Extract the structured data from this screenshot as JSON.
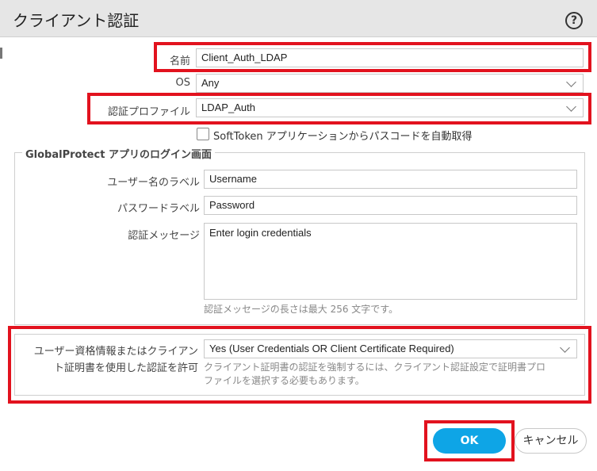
{
  "dialog": {
    "title": "クライアント認証",
    "help_icon": "question-circle-icon"
  },
  "form": {
    "name_label": "名前",
    "name_value": "Client_Auth_LDAP",
    "os_label": "OS",
    "os_value": "Any",
    "auth_profile_label": "認証プロファイル",
    "auth_profile_value": "LDAP_Auth",
    "softtoken_label": "SoftToken アプリケーションからパスコードを自動取得",
    "softtoken_checked": false
  },
  "login_screen": {
    "legend": "GlobalProtect アプリのログイン画面",
    "username_label": "ユーザー名のラベル",
    "username_value": "Username",
    "password_label": "パスワードラベル",
    "password_value": "Password",
    "message_label": "認証メッセージ",
    "message_value": "Enter login credentials",
    "message_hint": "認証メッセージの長さは最大 256 文字です。"
  },
  "cert_section": {
    "label_line1": "ユーザー資格情報またはクライアン",
    "label_line2": "ト証明書を使用した認証を許可",
    "value": "Yes (User Credentials OR Client Certificate Required)",
    "hint_line1": "クライアント証明書の認証を強制するには、クライアント認証設定で証明書プロ",
    "hint_line2": "ファイルを選択する必要もあります。"
  },
  "buttons": {
    "ok": "OK",
    "cancel": "キャンセル"
  },
  "colors": {
    "highlight": "#e2121e",
    "ok_button": "#0ea5e6"
  }
}
